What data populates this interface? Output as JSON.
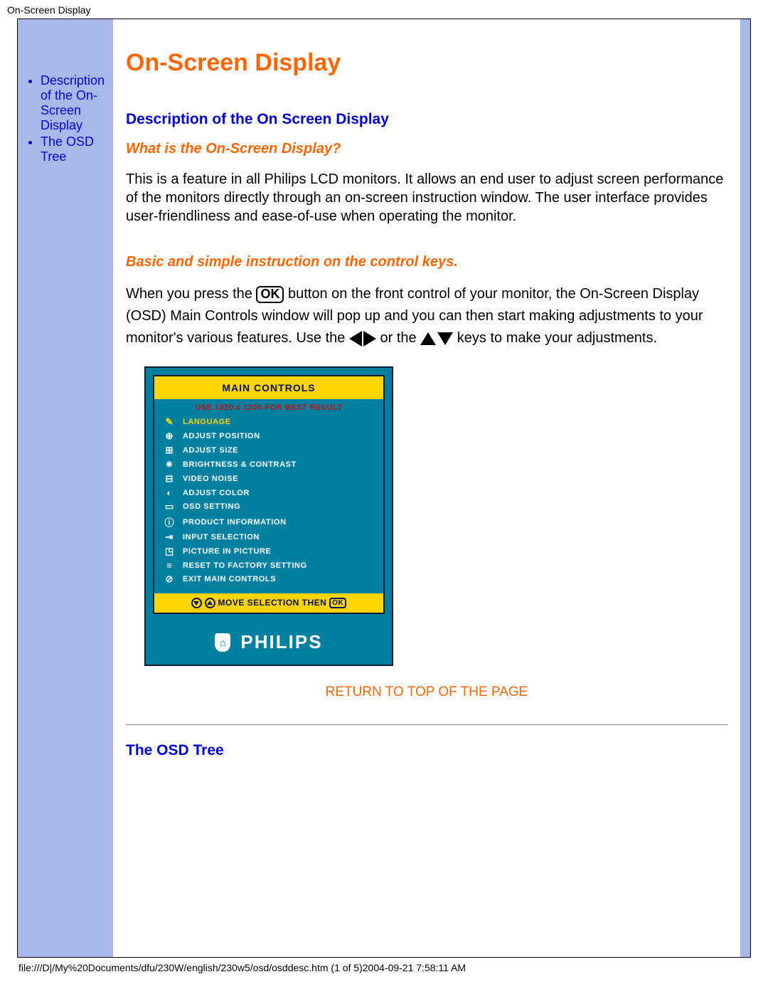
{
  "page_header": "On-Screen Display",
  "sidebar": {
    "items": [
      {
        "label": "Description of the On-Screen Display"
      },
      {
        "label": "The OSD Tree"
      }
    ]
  },
  "title": "On-Screen Display",
  "section1": {
    "heading": "Description of the On Screen Display",
    "sub1": "What is the On-Screen Display?",
    "para1": "This is a feature in all Philips LCD monitors. It allows an end user to adjust screen performance of the monitors directly through an on-screen instruction window. The user interface provides user-friendliness and ease-of-use when operating the monitor.",
    "sub2": "Basic and simple instruction on the control keys.",
    "para2_a": "When you press the ",
    "para2_b": " button on the front control of your monitor, the On-Screen Display (OSD) Main Controls window will pop up and you can then start making adjustments to your monitor's various features. Use the ",
    "para2_c": " or the ",
    "para2_d": " keys to make your adjustments."
  },
  "osd": {
    "header": "MAIN CONTROLS",
    "warn": "USE 1920 x 1200 FOR BEST RESULT",
    "items": [
      {
        "icon": "✎",
        "label": "LANGUAGE",
        "class": "lang"
      },
      {
        "icon": "⊕",
        "label": "ADJUST POSITION"
      },
      {
        "icon": "⊞",
        "label": "ADJUST SIZE"
      },
      {
        "icon": "✷",
        "label": "BRIGHTNESS & CONTRAST"
      },
      {
        "icon": "⊟",
        "label": "VIDEO NOISE"
      },
      {
        "icon": "◐",
        "label": "ADJUST COLOR"
      },
      {
        "icon": "▭",
        "label": "OSD SETTING"
      },
      {
        "icon": "ⓘ",
        "label": "PRODUCT INFORMATION"
      },
      {
        "icon": "⇥",
        "label": "INPUT SELECTION"
      },
      {
        "icon": "◳",
        "label": "PICTURE IN PICTURE"
      },
      {
        "icon": "≡",
        "label": "RESET TO FACTORY SETTING"
      },
      {
        "icon": "⊘",
        "label": "EXIT MAIN CONTROLS"
      }
    ],
    "footer_a": "MOVE SELECTION THEN",
    "brand": "PHILIPS"
  },
  "return_link": "RETURN TO TOP OF THE PAGE",
  "section2_heading": "The OSD Tree",
  "footer": "file:///D|/My%20Documents/dfu/230W/english/230w5/osd/osddesc.htm (1 of 5)2004-09-21 7:58:11 AM"
}
